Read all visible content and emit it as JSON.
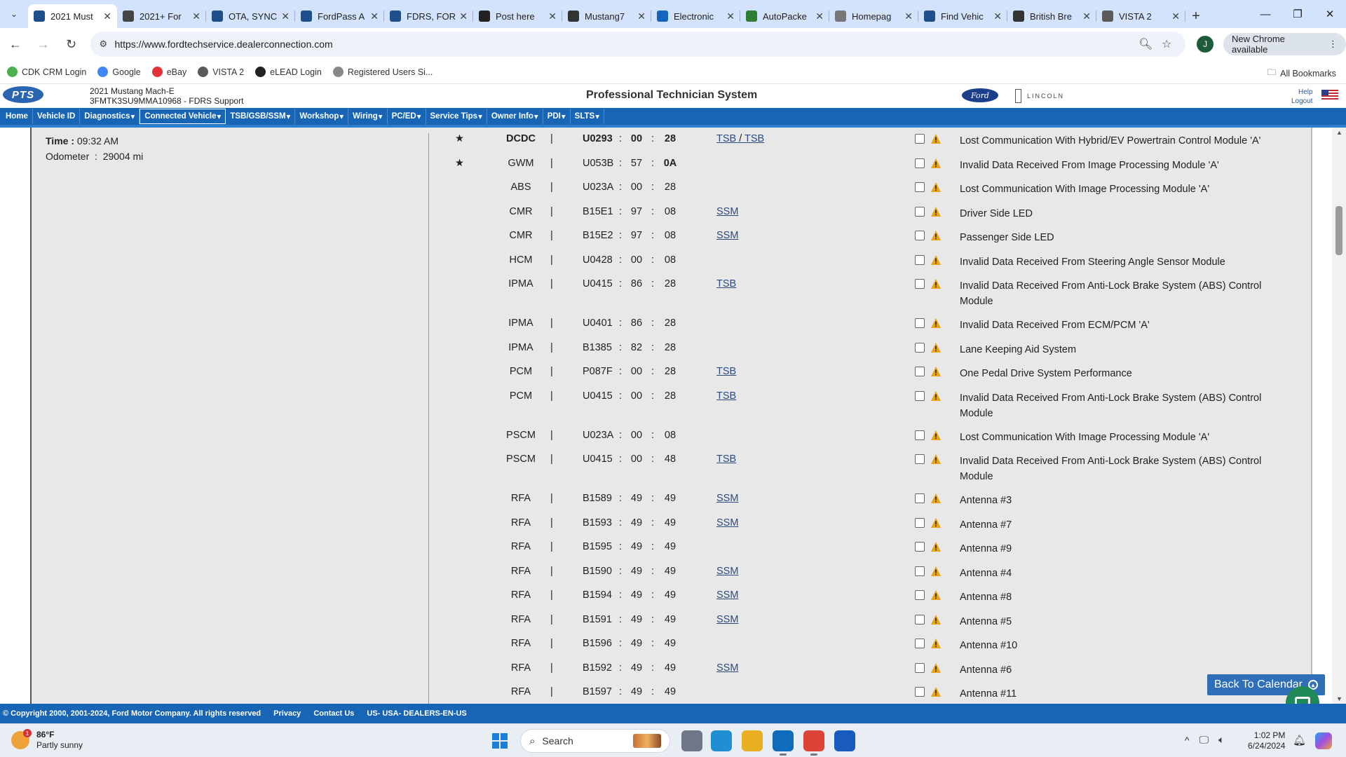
{
  "browser": {
    "tabs": [
      {
        "label": "2021 Must",
        "active": true,
        "icon": "ford-tech-icon",
        "color": "#1f4e8c"
      },
      {
        "label": "2021+ For",
        "icon": "fdrs-icon",
        "color": "#444444"
      },
      {
        "label": "OTA, SYNC",
        "icon": "chat-icon",
        "color": "#1f4e8c"
      },
      {
        "label": "FordPass A",
        "icon": "ford-tech-icon",
        "color": "#1f4e8c"
      },
      {
        "label": "FDRS, FOR",
        "icon": "ford-tech-icon",
        "color": "#1f4e8c"
      },
      {
        "label": "Post here",
        "icon": "forum-icon",
        "color": "#222222"
      },
      {
        "label": "Mustang7",
        "icon": "mach-e-forum-icon",
        "color": "#333333"
      },
      {
        "label": "Electronic",
        "icon": "electronic-icon",
        "color": "#1565c0"
      },
      {
        "label": "AutoPacke",
        "icon": "autopacket-icon",
        "color": "#2e7d32"
      },
      {
        "label": "Homepag",
        "icon": "homepage-icon",
        "color": "#777777"
      },
      {
        "label": "Find Vehic",
        "icon": "find-vehicle-icon",
        "color": "#1f4e8c"
      },
      {
        "label": "British Bre",
        "icon": "british-icon",
        "color": "#333333"
      },
      {
        "label": "VISTA 2",
        "icon": "vista-icon",
        "color": "#5a5a5a"
      }
    ],
    "url": "https://www.fordtechservice.dealerconnection.com",
    "new_chrome_label": "New Chrome available",
    "profile_initial": "J",
    "bookmarks": [
      {
        "label": "CDK CRM Login",
        "color": "#4caf50"
      },
      {
        "label": "Google",
        "color": "#4285f4"
      },
      {
        "label": "eBay",
        "color": "#e53238"
      },
      {
        "label": "VISTA 2",
        "color": "#5a5a5a"
      },
      {
        "label": "eLEAD Login",
        "color": "#222222"
      },
      {
        "label": "Registered Users Si...",
        "color": "#888888"
      }
    ],
    "all_bookmarks_label": "All Bookmarks"
  },
  "pts": {
    "logo_text": "PTS",
    "vehicle_line1": "2021 Mustang Mach-E",
    "vehicle_line2": "3FMTK3SU9MMA10968 - FDRS Support",
    "title": "Professional Technician System",
    "ford_logo_text": "Ford",
    "lincoln_text": "LINCOLN",
    "help_label": "Help",
    "logout_label": "Logout",
    "nav": [
      "Home",
      "Vehicle ID",
      "Diagnostics",
      "Connected Vehicle",
      "TSB/GSB/SSM",
      "Workshop",
      "Wiring",
      "PC/ED",
      "Service Tips",
      "Owner Info",
      "PDI",
      "SLTS"
    ]
  },
  "session": {
    "time_label": "Time :",
    "time_value": "09:32 AM",
    "odometer_label": "Odometer",
    "odometer_value": "29004 mi"
  },
  "dtcs": [
    {
      "star": true,
      "bold": true,
      "module": "DCDC",
      "code": "U0293",
      "b1": "00",
      "b2": "28",
      "links": [
        "TSB",
        "TSB"
      ],
      "desc": "Lost Communication With Hybrid/EV Powertrain Control Module 'A'"
    },
    {
      "star": true,
      "semibold": true,
      "module": "GWM",
      "code": "U053B",
      "b1": "57",
      "b2": "0A",
      "links": [],
      "desc": "Invalid Data Received From Image Processing Module 'A'"
    },
    {
      "module": "ABS",
      "code": "U023A",
      "b1": "00",
      "b2": "28",
      "links": [],
      "desc": "Lost Communication With Image Processing Module 'A'"
    },
    {
      "module": "CMR",
      "code": "B15E1",
      "b1": "97",
      "b2": "08",
      "links": [
        "SSM"
      ],
      "desc": "Driver Side LED"
    },
    {
      "module": "CMR",
      "code": "B15E2",
      "b1": "97",
      "b2": "08",
      "links": [
        "SSM"
      ],
      "desc": "Passenger Side LED"
    },
    {
      "module": "HCM",
      "code": "U0428",
      "b1": "00",
      "b2": "08",
      "links": [],
      "desc": "Invalid Data Received From Steering Angle Sensor Module"
    },
    {
      "module": "IPMA",
      "code": "U0415",
      "b1": "86",
      "b2": "28",
      "links": [
        "TSB"
      ],
      "desc": "Invalid Data Received From Anti-Lock Brake System (ABS) Control Module",
      "tall": true
    },
    {
      "module": "IPMA",
      "code": "U0401",
      "b1": "86",
      "b2": "28",
      "links": [],
      "desc": "Invalid Data Received From ECM/PCM 'A'"
    },
    {
      "module": "IPMA",
      "code": "B1385",
      "b1": "82",
      "b2": "28",
      "links": [],
      "desc": "Lane Keeping Aid System"
    },
    {
      "module": "PCM",
      "code": "P087F",
      "b1": "00",
      "b2": "28",
      "links": [
        "TSB"
      ],
      "desc": "One Pedal Drive System Performance"
    },
    {
      "module": "PCM",
      "code": "U0415",
      "b1": "00",
      "b2": "28",
      "links": [
        "TSB"
      ],
      "desc": "Invalid Data Received From Anti-Lock Brake System (ABS) Control Module",
      "tall": true
    },
    {
      "module": "PSCM",
      "code": "U023A",
      "b1": "00",
      "b2": "08",
      "links": [],
      "desc": "Lost Communication With Image Processing Module 'A'"
    },
    {
      "module": "PSCM",
      "code": "U0415",
      "b1": "00",
      "b2": "48",
      "links": [
        "TSB"
      ],
      "desc": "Invalid Data Received From Anti-Lock Brake System (ABS) Control Module",
      "tall": true
    },
    {
      "module": "RFA",
      "code": "B1589",
      "b1": "49",
      "b2": "49",
      "links": [
        "SSM"
      ],
      "desc": "Antenna #3"
    },
    {
      "module": "RFA",
      "code": "B1593",
      "b1": "49",
      "b2": "49",
      "links": [
        "SSM"
      ],
      "desc": "Antenna #7"
    },
    {
      "module": "RFA",
      "code": "B1595",
      "b1": "49",
      "b2": "49",
      "links": [],
      "desc": "Antenna #9"
    },
    {
      "module": "RFA",
      "code": "B1590",
      "b1": "49",
      "b2": "49",
      "links": [
        "SSM"
      ],
      "desc": "Antenna #4"
    },
    {
      "module": "RFA",
      "code": "B1594",
      "b1": "49",
      "b2": "49",
      "links": [
        "SSM"
      ],
      "desc": "Antenna #8"
    },
    {
      "module": "RFA",
      "code": "B1591",
      "b1": "49",
      "b2": "49",
      "links": [
        "SSM"
      ],
      "desc": "Antenna #5"
    },
    {
      "module": "RFA",
      "code": "B1596",
      "b1": "49",
      "b2": "49",
      "links": [],
      "desc": "Antenna #10"
    },
    {
      "module": "RFA",
      "code": "B1592",
      "b1": "49",
      "b2": "49",
      "links": [
        "SSM"
      ],
      "desc": "Antenna #6"
    },
    {
      "module": "RFA",
      "code": "B1597",
      "b1": "49",
      "b2": "49",
      "links": [],
      "desc": "Antenna #11"
    }
  ],
  "back_to_calendar": "Back To Calendar",
  "footer": {
    "copyright": "© Copyright 2000, 2001-2024, Ford Motor Company. All rights reserved",
    "privacy": "Privacy",
    "contact": "Contact Us",
    "locale": "US- USA- DEALERS-EN-US"
  },
  "taskbar": {
    "temp": "86°F",
    "condition": "Partly sunny",
    "weather_badge": "1",
    "search_placeholder": "Search",
    "time": "1:02 PM",
    "date": "6/24/2024",
    "apps": [
      {
        "name": "task-view-icon",
        "color": "#6d7787",
        "running": false
      },
      {
        "name": "edge-icon",
        "color": "#1f8fd1",
        "running": false
      },
      {
        "name": "file-explorer-icon",
        "color": "#e8b021",
        "running": false
      },
      {
        "name": "outlook-icon",
        "color": "#0f6cbd",
        "running": true
      },
      {
        "name": "chrome-icon",
        "color": "#db4437",
        "running": true
      },
      {
        "name": "word-icon",
        "color": "#185abd",
        "running": false
      }
    ]
  },
  "colors": {
    "accent": "#1765b4",
    "warning": "#e8a317",
    "link": "#2b4a80"
  }
}
